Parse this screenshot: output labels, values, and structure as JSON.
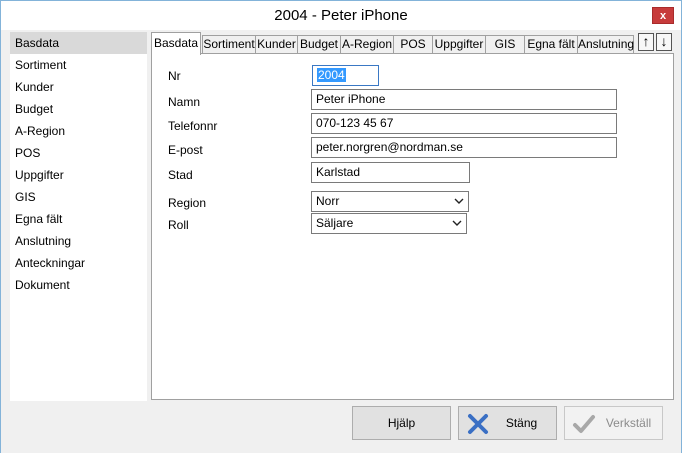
{
  "window": {
    "title": "2004 - Peter iPhone",
    "close_label": "x"
  },
  "sidebar": {
    "items": [
      {
        "label": "Basdata"
      },
      {
        "label": "Sortiment"
      },
      {
        "label": "Kunder"
      },
      {
        "label": "Budget"
      },
      {
        "label": "A-Region"
      },
      {
        "label": "POS"
      },
      {
        "label": "Uppgifter"
      },
      {
        "label": "GIS"
      },
      {
        "label": "Egna fält"
      },
      {
        "label": "Anslutning"
      },
      {
        "label": "Anteckningar"
      },
      {
        "label": "Dokument"
      }
    ],
    "selected": "Basdata"
  },
  "tabs": {
    "items": [
      {
        "label": "Basdata"
      },
      {
        "label": "Sortiment"
      },
      {
        "label": "Kunder"
      },
      {
        "label": "Budget"
      },
      {
        "label": "A-Region"
      },
      {
        "label": "POS"
      },
      {
        "label": "Uppgifter"
      },
      {
        "label": "GIS"
      },
      {
        "label": "Egna fält"
      },
      {
        "label": "Anslutning"
      }
    ],
    "active": "Basdata",
    "scroll_up_icon": "arrow-up-icon",
    "scroll_down_icon": "arrow-down-icon"
  },
  "form": {
    "nr": {
      "label": "Nr",
      "value": "2004"
    },
    "namn": {
      "label": "Namn",
      "value": "Peter iPhone"
    },
    "telefonnr": {
      "label": "Telefonnr",
      "value": "070-123 45 67"
    },
    "epost": {
      "label": "E-post",
      "value": "peter.norgren@nordman.se"
    },
    "stad": {
      "label": "Stad",
      "value": "Karlstad"
    },
    "region": {
      "label": "Region",
      "value": "Norr"
    },
    "roll": {
      "label": "Roll",
      "value": "Säljare"
    }
  },
  "buttons": {
    "help": "Hjälp",
    "close": "Stäng",
    "apply": "Verkställ"
  },
  "colors": {
    "selection": "#3399ff",
    "close_button": "#c73b3b",
    "close_icon": "#3a6fc4",
    "check_icon": "#a8a8a8"
  }
}
